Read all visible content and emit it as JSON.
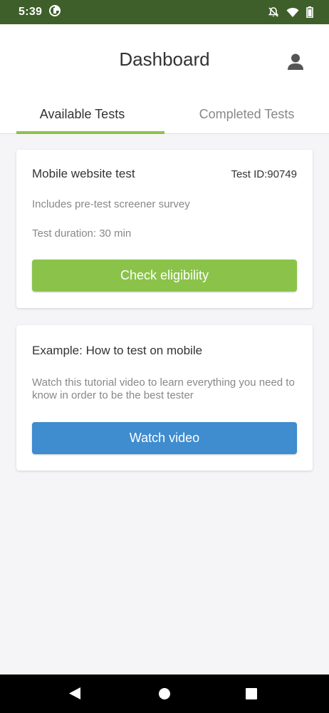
{
  "status_bar": {
    "time": "5:39",
    "background_color": "#3f5f2a",
    "icons": [
      "data-saver-icon",
      "notifications-off-icon",
      "wifi-icon",
      "battery-icon"
    ]
  },
  "header": {
    "title": "Dashboard",
    "icon": "user-profile-icon"
  },
  "tabs": [
    {
      "label": "Available Tests",
      "active": true
    },
    {
      "label": "Completed Tests",
      "active": false
    }
  ],
  "accent_color": "#8bc34a",
  "cards": [
    {
      "title": "Mobile website test",
      "test_id": "Test ID:90749",
      "description": "Includes pre-test screener survey",
      "duration": "Test duration: 30 min",
      "button_label": "Check eligibility",
      "button_color": "#8bc34a"
    },
    {
      "title": "Example: How to test on mobile",
      "description": "Watch this tutorial video to learn everything you need to know in order to be the best tester",
      "button_label": "Watch video",
      "button_color": "#3f8ccf"
    }
  ],
  "nav_bar": {
    "buttons": [
      "back-icon",
      "home-icon",
      "recents-icon"
    ]
  }
}
